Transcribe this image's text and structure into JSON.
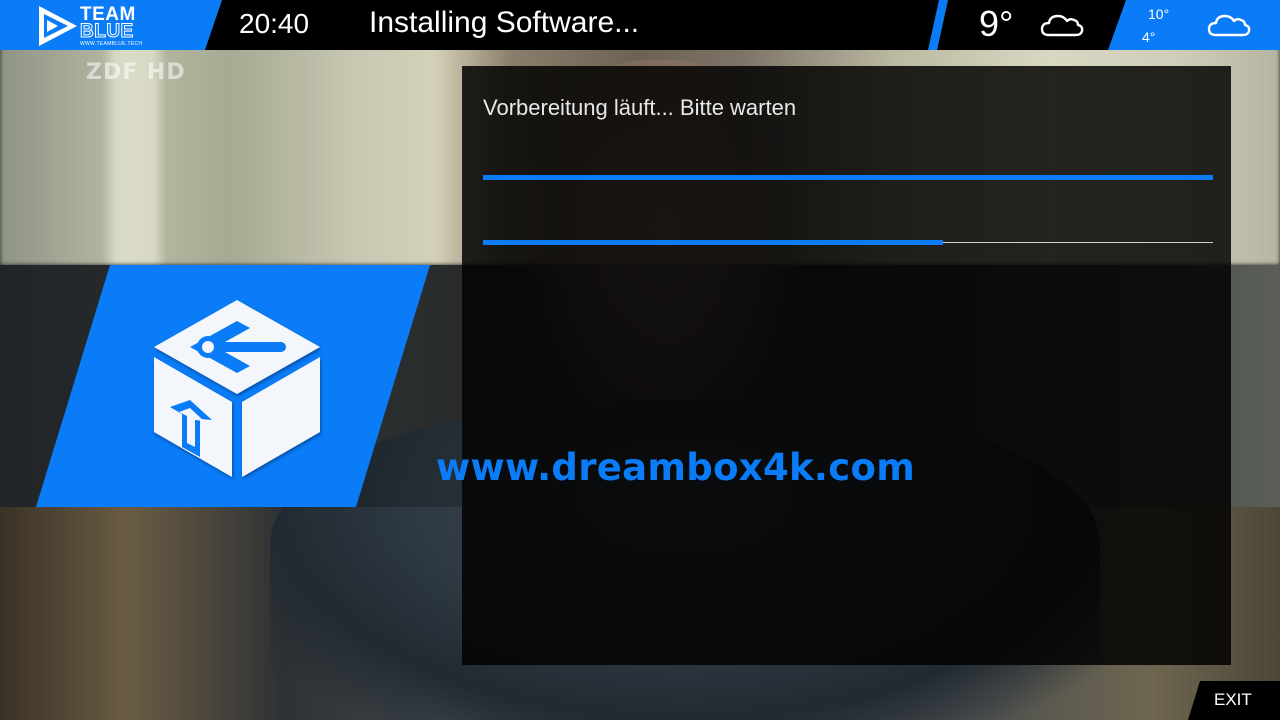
{
  "header": {
    "logo_line1": "TEAM",
    "logo_line2": "BLUE",
    "logo_url": "WWW.TEAMBLUE.TECH",
    "clock": "20:40",
    "title": "Installing Software...",
    "weather": {
      "current_temp": "9°",
      "current_icon": "cloud-icon",
      "forecast_high": "10°",
      "forecast_low": "4°",
      "forecast_icon": "cloud-icon"
    }
  },
  "background": {
    "channel_logo": "ZDF HD"
  },
  "plugin": {
    "icon": "software-package-icon"
  },
  "dialog": {
    "status": "Vorbereitung läuft... Bitte warten",
    "progress": [
      {
        "name": "total",
        "percent": 100
      },
      {
        "name": "current",
        "percent": 63
      }
    ]
  },
  "watermark": "www.dreambox4k.com",
  "footer": {
    "exit_label": "EXIT"
  },
  "colors": {
    "accent": "#0a7cf7",
    "header_bg": "#000000",
    "dialog_bg": "#000000"
  }
}
